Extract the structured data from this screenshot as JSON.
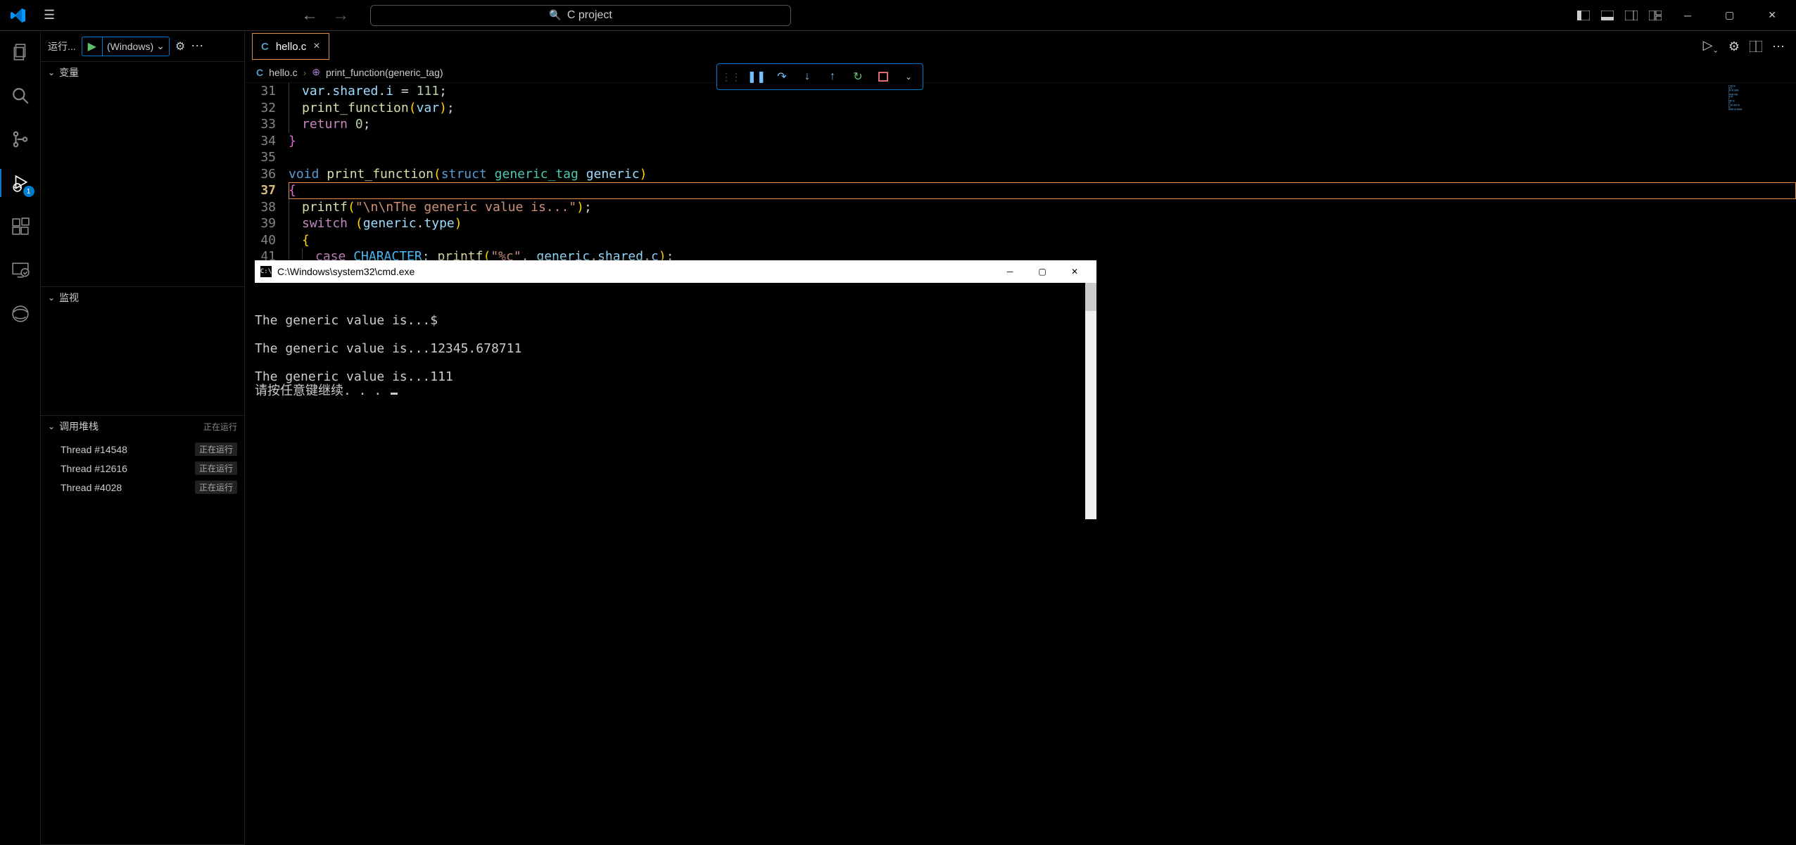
{
  "titlebar": {
    "search_placeholder": "C project"
  },
  "sidebar_run": {
    "label": "运行...",
    "config": "(Windows)"
  },
  "sections": {
    "variables": "变量",
    "watch": "监视",
    "callstack": "调用堆栈",
    "callstack_status": "正在运行"
  },
  "threads": [
    {
      "name": "Thread #14548",
      "status": "正在运行"
    },
    {
      "name": "Thread #12616",
      "status": "正在运行"
    },
    {
      "name": "Thread #4028",
      "status": "正在运行"
    }
  ],
  "tab": {
    "file": "hello.c"
  },
  "breadcrumb": {
    "file": "hello.c",
    "symbol": "print_function(generic_tag)"
  },
  "code_lines": [
    {
      "n": 31,
      "html": "<span class='indent'></span><span class='var'>var</span><span class='punc'>.</span><span class='var'>shared</span><span class='punc'>.</span><span class='var'>i</span> <span class='punc'>=</span> <span class='num'>111</span><span class='punc'>;</span>"
    },
    {
      "n": 32,
      "html": "<span class='indent'></span><span class='fn'>print_function</span><span class='brace2'>(</span><span class='var'>var</span><span class='brace2'>)</span><span class='punc'>;</span>"
    },
    {
      "n": 33,
      "html": "<span class='indent'></span><span class='ctrl'>return</span> <span class='num'>0</span><span class='punc'>;</span>"
    },
    {
      "n": 34,
      "html": "<span class='brace'>}</span>"
    },
    {
      "n": 35,
      "html": ""
    },
    {
      "n": 36,
      "html": "<span class='kw'>void</span> <span class='fn'>print_function</span><span class='brace2'>(</span><span class='kw'>struct</span> <span class='typ'>generic_tag</span> <span class='var'>generic</span><span class='brace2'>)</span>"
    },
    {
      "n": 37,
      "html": "<span class='brace'>{</span>",
      "current": true
    },
    {
      "n": 38,
      "html": "<span class='indent'></span><span class='fn'>printf</span><span class='brace2'>(</span><span class='str'>\"\\n\\nThe generic value is...\"</span><span class='brace2'>)</span><span class='punc'>;</span>"
    },
    {
      "n": 39,
      "html": "<span class='indent'></span><span class='ctrl'>switch</span> <span class='brace2'>(</span><span class='var'>generic</span><span class='punc'>.</span><span class='var'>type</span><span class='brace2'>)</span>"
    },
    {
      "n": 40,
      "html": "<span class='indent'></span><span class='brace2'>{</span>"
    },
    {
      "n": 41,
      "html": "<span class='indent'></span><span class='indent'></span><span class='ctrl'>case</span> <span class='con'>CHARACTER</span><span class='punc'>:</span> <span class='fn'>printf</span><span class='brace2'>(</span><span class='str'>\"%c\"</span><span class='punc'>,</span> <span class='var'>generic</span><span class='punc'>.</span><span class='var'>shared</span><span class='punc'>.</span><span class='var'>c</span><span class='brace2'>)</span><span class='punc'>;</span>"
    }
  ],
  "cmd": {
    "title": "C:\\Windows\\system32\\cmd.exe",
    "output": "\n\nThe generic value is...$\n\nThe generic value is...12345.678711\n\nThe generic value is...111\n请按任意键继续. . . "
  },
  "debug_badge": "1"
}
